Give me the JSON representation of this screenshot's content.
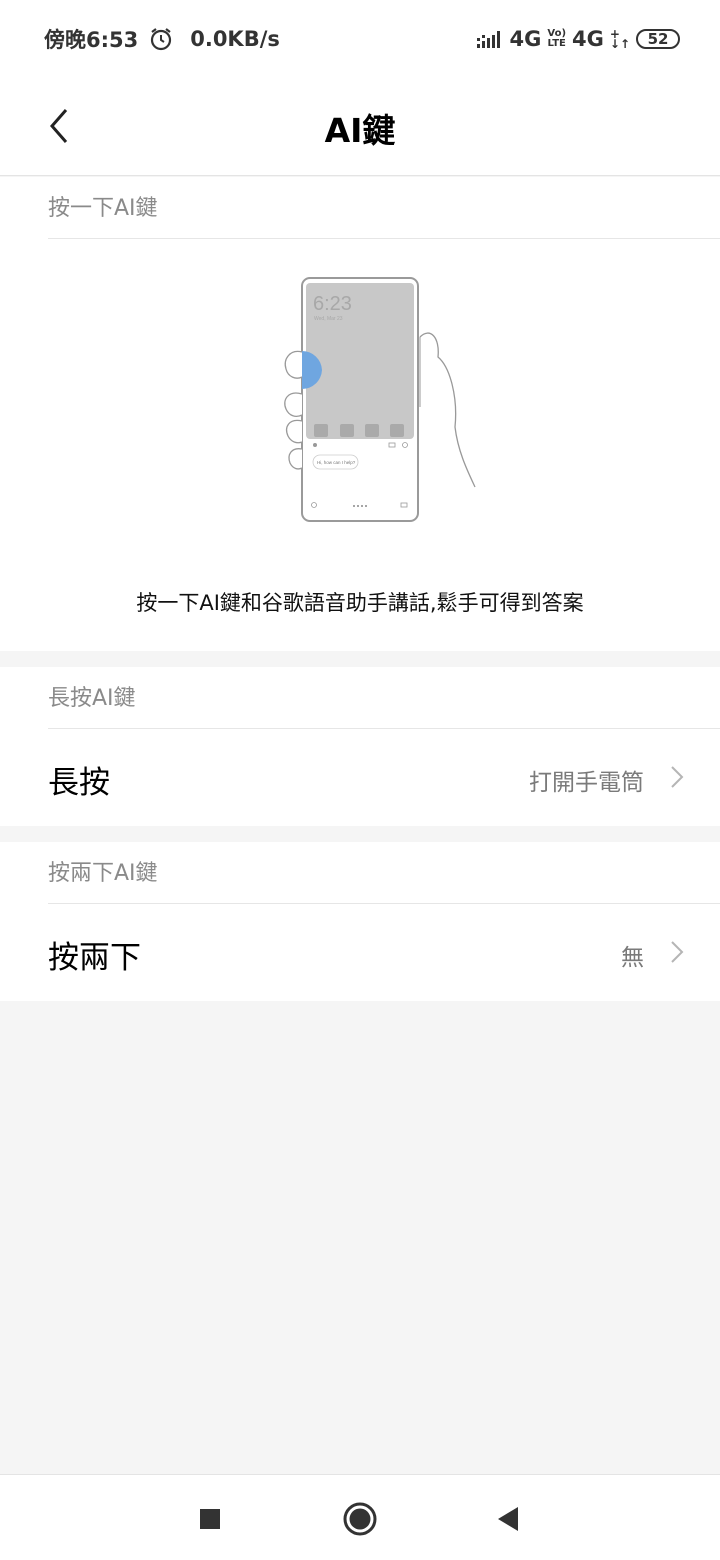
{
  "status_bar": {
    "time": "傍晚6:53",
    "net_speed": "0.0KB/s",
    "network1": "4G",
    "volte_top": "Vo)",
    "volte_bottom": "LTE",
    "network2": "4G",
    "battery": "52"
  },
  "header": {
    "title": "AI鍵"
  },
  "sections": {
    "single_press": {
      "title": "按一下AI鍵",
      "illustration": {
        "clock": "6:23",
        "date": "Wed, Mar 23",
        "assistant_prompt": "Hi, how can I help?"
      },
      "caption": "按一下AI鍵和谷歌語音助手講話,鬆手可得到答案"
    },
    "long_press": {
      "title": "長按AI鍵",
      "row_label": "長按",
      "row_value": "打開手電筒"
    },
    "double_press": {
      "title": "按兩下AI鍵",
      "row_label": "按兩下",
      "row_value": "無"
    }
  },
  "colors": {
    "background": "#f5f5f5",
    "card": "#ffffff",
    "secondary_text": "#8a8a8a",
    "illustration_blue": "#6fa6e0"
  },
  "icons": {
    "back": "back-arrow-icon",
    "chevron": "chevron-right-icon",
    "alarm": "alarm-clock-icon",
    "nav_recents": "square-icon",
    "nav_home": "circle-icon",
    "nav_back": "triangle-back-icon"
  }
}
